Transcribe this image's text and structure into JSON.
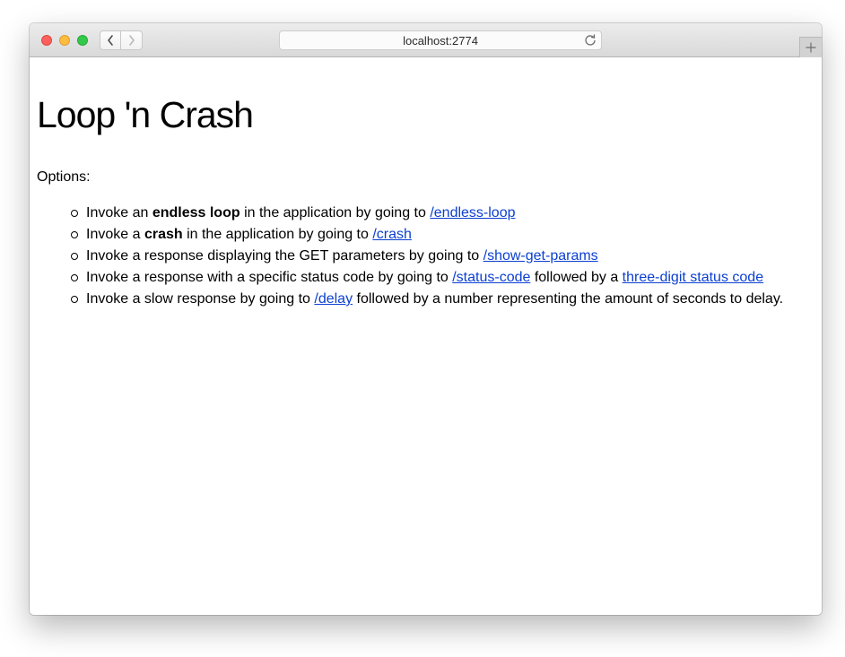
{
  "browser": {
    "url": "localhost:2774",
    "icons": {
      "back": "chevron-left-icon",
      "forward": "chevron-right-icon",
      "reload": "reload-icon",
      "new_tab": "plus-icon"
    }
  },
  "page": {
    "title": "Loop 'n Crash",
    "options_label": "Options:",
    "items": [
      {
        "text_1": "Invoke an ",
        "bold": "endless loop",
        "text_2": " in the application by going to ",
        "link_1": "/endless-loop"
      },
      {
        "text_1": "Invoke a ",
        "bold": "crash",
        "text_2": " in the application by going to ",
        "link_1": "/crash"
      },
      {
        "text_1": "Invoke a response displaying the GET parameters by going to ",
        "link_1": "/show-get-params"
      },
      {
        "text_1": "Invoke a response with a specific status code by going to ",
        "link_1": "/status-code",
        "text_2": " followed by a ",
        "link_2": "three-digit status code"
      },
      {
        "text_1": "Invoke a slow response by going to ",
        "link_1": "/delay",
        "text_2": " followed by a number representing the amount of seconds to delay."
      }
    ],
    "link_color": "#0b3fd1"
  }
}
